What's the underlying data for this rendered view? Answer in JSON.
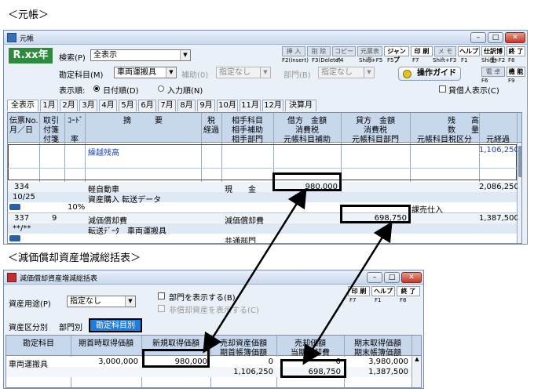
{
  "captions": {
    "ledger": "＜元帳＞",
    "depreciation": "＜減価償却資産増減総括表＞"
  },
  "ledger_window": {
    "title": "元帳",
    "era_badge": "R.xx年",
    "toolbar": [
      {
        "label": "挿 入",
        "key": "F2(Insert)",
        "enabled": false
      },
      {
        "label": "削 除",
        "key": "F3(Delete)",
        "enabled": false
      },
      {
        "label": "コピー",
        "key": "F4",
        "enabled": false
      },
      {
        "label": "元票表示",
        "key": "Shift+F5",
        "enabled": false
      },
      {
        "label": "ジャンプ",
        "key": "F5",
        "enabled": true
      },
      {
        "label": "印 刷",
        "key": "F7",
        "enabled": true
      },
      {
        "label": "メ モ",
        "key": "Shift+F3",
        "enabled": false
      },
      {
        "label": "ヘルプ",
        "key": "F1",
        "enabled": true
      },
      {
        "label": "仕訳博士",
        "key": "Shift+F2",
        "enabled": true
      },
      {
        "label": "終 了",
        "key": "F8",
        "enabled": true
      }
    ],
    "toolbar2": [
      {
        "label": "電 卓",
        "key": "F6"
      },
      {
        "label": "機 能",
        "key": "F9"
      }
    ],
    "search_label": "検索(P)",
    "search_value": "全表示",
    "account_label": "勘定科目(M)",
    "account_value": "車両運搬具",
    "aux_label": "補助(0)",
    "aux_value": "指定なし",
    "dept_label": "部門(B)",
    "dept_value": "指定なし",
    "guide_button": "操作ガイド",
    "display_label": "表示順:",
    "order_date": "日付順(D)",
    "order_input": "入力順(N)",
    "lender_checkbox": "貸借人表示(C)",
    "tabs": [
      "全表示",
      "1月",
      "2月",
      "3月",
      "4月",
      "5月",
      "6月",
      "7月",
      "8月",
      "9月",
      "10月",
      "11月",
      "12月",
      "決算月"
    ],
    "headers": {
      "c1": [
        "伝票No.",
        "月／日"
      ],
      "c2": [
        "取引",
        "付箋",
        "付箋"
      ],
      "c3": [
        "ｺｰﾄﾞ",
        "",
        "率"
      ],
      "c4": "摘　　　要",
      "c5": [
        "税",
        "経過"
      ],
      "c6": [
        "相手科目",
        "相手補助",
        "相手部門"
      ],
      "c7": [
        "借方　金額",
        "消費税",
        "元帳科目補助"
      ],
      "c8": [
        "貸方　金額",
        "消費税",
        "元帳科目部門"
      ],
      "c9": [
        "残　　高",
        "数　　量",
        "元帳科目税区分"
      ],
      "c10": "元経過"
    },
    "rows": {
      "carry_label": "繰越残高",
      "carry_balance": "1,106,250",
      "r1_no": "334",
      "r1_date": "10/25",
      "r1_desc1": "軽自動車",
      "r1_desc2": "資産購入 転送データ",
      "r1_rate": "10%",
      "r1_partner": "現　　金",
      "r1_debit": "980,000",
      "r1_balance": "2,086,250",
      "r1_tax": "課売仕入",
      "r2_no": "337",
      "r2_date": "**/**",
      "r2_code": "9",
      "r2_desc1": "減価償却費",
      "r2_desc2": "転送ﾃﾞｰﾀ　車両運搬具",
      "r2_partner": "減価償却費",
      "r2_partner_dept": "共通部門",
      "r2_credit": "698,750",
      "r2_balance": "1,387,500"
    }
  },
  "dep_window": {
    "title": "減価償却資産増減総括表",
    "usage_label": "資産用途(P)",
    "usage_value": "指定なし",
    "show_dept": "部門を表示する(B)",
    "non_dep": "非償却資産を表示する(C)",
    "toolbar": [
      {
        "label": "印 刷",
        "key": "F7"
      },
      {
        "label": "ヘルプ",
        "key": "F1"
      },
      {
        "label": "終 了",
        "key": "F8"
      }
    ],
    "tabs": [
      "資産区分別",
      "部門別",
      "勘定科目別"
    ],
    "headers": {
      "h1": "勘定科目",
      "h2": "期首時取得価額",
      "h3": "新規取得価額",
      "h4": [
        "売却資産価額",
        "期首帳簿価額"
      ],
      "h5": [
        "売却価額",
        "当期償却費"
      ],
      "h6": [
        "期末取得価額",
        "期末帳簿価額"
      ]
    },
    "row": {
      "account": "車両運搬具",
      "start_cost": "3,000,000",
      "new_cost": "980,000",
      "sale_asset": "0",
      "sale_price": "0",
      "end_cost": "3,980,000",
      "start_book": "1,106,250",
      "depreciation": "698,750",
      "end_book": "1,387,500"
    }
  }
}
